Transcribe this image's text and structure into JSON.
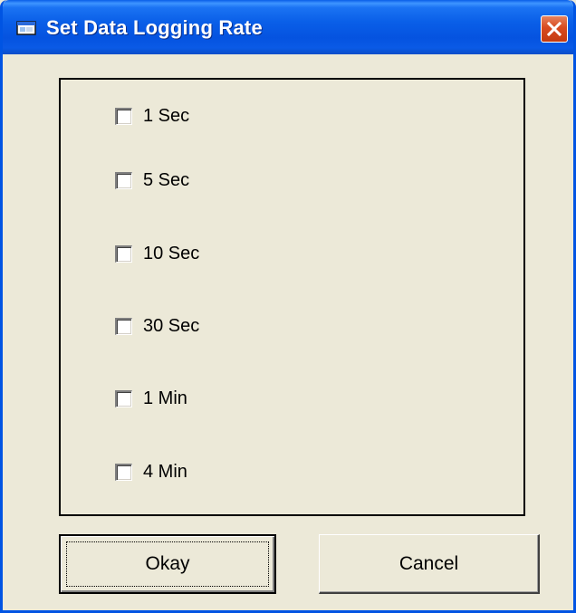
{
  "window": {
    "title": "Set Data Logging Rate",
    "titlebar_color": "#0A5FE8",
    "close_icon": "close-icon"
  },
  "options": [
    {
      "label": "1 Sec",
      "checked": false
    },
    {
      "label": "5 Sec",
      "checked": false
    },
    {
      "label": "10 Sec",
      "checked": false
    },
    {
      "label": "30 Sec",
      "checked": false
    },
    {
      "label": "1 Min",
      "checked": false
    },
    {
      "label": "4 Min",
      "checked": false
    }
  ],
  "buttons": {
    "okay_label": "Okay",
    "cancel_label": "Cancel"
  }
}
